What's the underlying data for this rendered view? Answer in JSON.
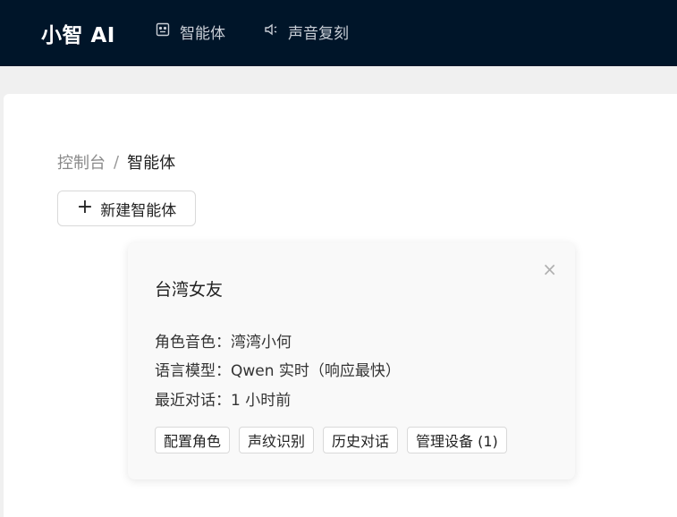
{
  "header": {
    "logo": "小智 AI",
    "nav": [
      {
        "label": "智能体",
        "icon": "robot-icon"
      },
      {
        "label": "声音复刻",
        "icon": "speaker-icon"
      }
    ]
  },
  "breadcrumb": {
    "root": "控制台",
    "separator": "/",
    "current": "智能体"
  },
  "toolbar": {
    "new_agent_label": "新建智能体",
    "plus_icon": "+"
  },
  "agent_card": {
    "title": "台湾女友",
    "close_icon": "×",
    "voice_label": "角色音色：",
    "voice_value": "湾湾小何",
    "model_label": "语言模型：",
    "model_value": "Qwen 实时（响应最快）",
    "last_chat_label": "最近对话：",
    "last_chat_value": "1 小时前",
    "actions": {
      "configure": "配置角色",
      "voiceprint": "声纹识别",
      "history": "历史对话",
      "devices": "管理设备 (1)"
    }
  },
  "colors": {
    "header_bg": "#001529",
    "page_bg": "#f0f0f0",
    "card_bg": "#f9f9f9"
  }
}
